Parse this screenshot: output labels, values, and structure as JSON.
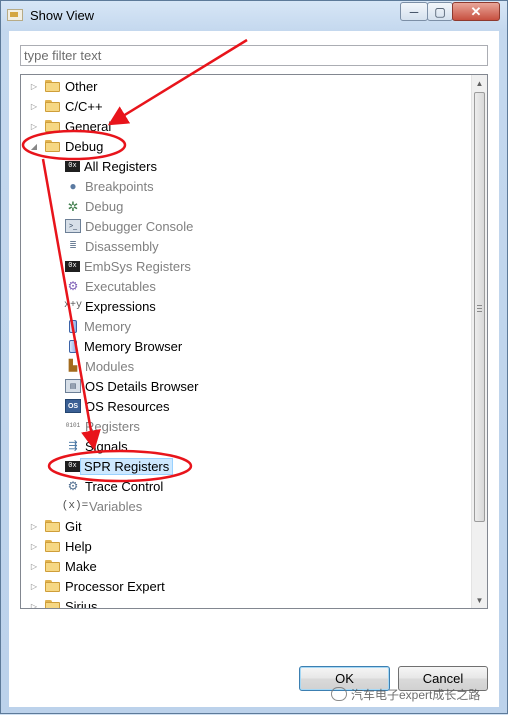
{
  "window": {
    "title": "Show View",
    "controls": {
      "minimize": "─",
      "maximize": "▢",
      "close": "✕"
    }
  },
  "filter": {
    "placeholder": "type filter text",
    "value": ""
  },
  "tree": {
    "categories_top": [
      {
        "label": "Other",
        "expanded": false
      },
      {
        "label": "C/C++",
        "expanded": false
      },
      {
        "label": "General",
        "expanded": false
      }
    ],
    "debug": {
      "label": "Debug",
      "expanded": true,
      "children": [
        {
          "label": "All Registers",
          "icon": "registers-icon",
          "enabled": true
        },
        {
          "label": "Breakpoints",
          "icon": "breakpoints-icon",
          "enabled": false
        },
        {
          "label": "Debug",
          "icon": "debug-bug-icon",
          "enabled": false
        },
        {
          "label": "Debugger Console",
          "icon": "console-icon",
          "enabled": false
        },
        {
          "label": "Disassembly",
          "icon": "disassembly-icon",
          "enabled": false
        },
        {
          "label": "EmbSys Registers",
          "icon": "registers-icon",
          "enabled": false
        },
        {
          "label": "Executables",
          "icon": "executables-icon",
          "enabled": false
        },
        {
          "label": "Expressions",
          "icon": "expressions-icon",
          "enabled": true
        },
        {
          "label": "Memory",
          "icon": "memory-icon",
          "enabled": false
        },
        {
          "label": "Memory Browser",
          "icon": "memory-icon",
          "enabled": true
        },
        {
          "label": "Modules",
          "icon": "modules-icon",
          "enabled": false
        },
        {
          "label": "OS Details Browser",
          "icon": "os-details-icon",
          "enabled": true
        },
        {
          "label": "OS Resources",
          "icon": "os-resources-icon",
          "enabled": true
        },
        {
          "label": "Registers",
          "icon": "binary-registers-icon",
          "enabled": false
        },
        {
          "label": "Signals",
          "icon": "signals-icon",
          "enabled": true
        },
        {
          "label": "SPR Registers",
          "icon": "registers-icon",
          "enabled": true,
          "selected": true
        },
        {
          "label": "Trace Control",
          "icon": "trace-control-icon",
          "enabled": true
        },
        {
          "label": "Variables",
          "icon": "variables-icon",
          "enabled": false
        }
      ]
    },
    "categories_bottom": [
      {
        "label": "Git",
        "expanded": false
      },
      {
        "label": "Help",
        "expanded": false
      },
      {
        "label": "Make",
        "expanded": false
      },
      {
        "label": "Processor Expert",
        "expanded": false
      },
      {
        "label": "Sirius",
        "expanded": false
      }
    ]
  },
  "buttons": {
    "ok": "OK",
    "cancel": "Cancel"
  },
  "watermark": {
    "text": "汽车电子expert成长之路"
  },
  "annotation": {
    "color": "#e8141b"
  }
}
